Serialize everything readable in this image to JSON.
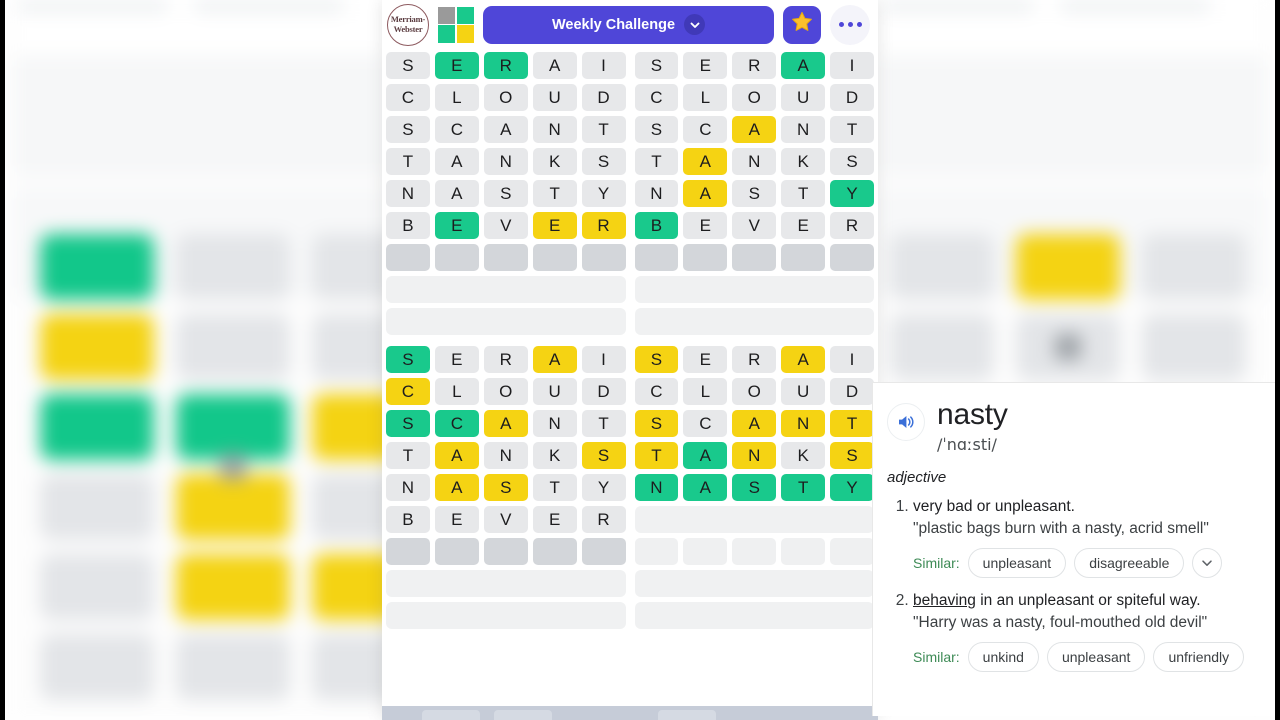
{
  "header": {
    "logo_text_line1": "Merriam-",
    "logo_text_line2": "Webster",
    "quad_icon_name": "quordle-quad-icon",
    "quad_colors": [
      "#9a9a9a",
      "#19c98c",
      "#19c98c",
      "#f5d313"
    ],
    "challenge_label": "Weekly Challenge",
    "star_icon": "star-icon",
    "more_icon": "more-options-icon",
    "accent_purple": "#4f46d8"
  },
  "colors": {
    "green": "#19c98c",
    "yellow": "#f5d313",
    "gray": "#e7e8ea",
    "active_gray": "#d3d6da",
    "placeholder": "#f0f1f2"
  },
  "boards": [
    {
      "name": "board-top-left",
      "solved": false,
      "rows": [
        {
          "letters": [
            "S",
            "E",
            "R",
            "A",
            "I"
          ],
          "states": [
            "gray",
            "green",
            "green",
            "gray",
            "gray"
          ]
        },
        {
          "letters": [
            "C",
            "L",
            "O",
            "U",
            "D"
          ],
          "states": [
            "gray",
            "gray",
            "gray",
            "gray",
            "gray"
          ]
        },
        {
          "letters": [
            "S",
            "C",
            "A",
            "N",
            "T"
          ],
          "states": [
            "gray",
            "gray",
            "gray",
            "gray",
            "gray"
          ]
        },
        {
          "letters": [
            "T",
            "A",
            "N",
            "K",
            "S"
          ],
          "states": [
            "gray",
            "gray",
            "gray",
            "gray",
            "gray"
          ]
        },
        {
          "letters": [
            "N",
            "A",
            "S",
            "T",
            "Y"
          ],
          "states": [
            "gray",
            "gray",
            "gray",
            "gray",
            "gray"
          ]
        },
        {
          "letters": [
            "B",
            "E",
            "V",
            "E",
            "R"
          ],
          "states": [
            "gray",
            "green",
            "gray",
            "yellow",
            "yellow"
          ]
        }
      ],
      "active_row": true,
      "placeholder_bars": 2
    },
    {
      "name": "board-top-right",
      "solved": false,
      "rows": [
        {
          "letters": [
            "S",
            "E",
            "R",
            "A",
            "I"
          ],
          "states": [
            "gray",
            "gray",
            "gray",
            "green",
            "gray"
          ]
        },
        {
          "letters": [
            "C",
            "L",
            "O",
            "U",
            "D"
          ],
          "states": [
            "gray",
            "gray",
            "gray",
            "gray",
            "gray"
          ]
        },
        {
          "letters": [
            "S",
            "C",
            "A",
            "N",
            "T"
          ],
          "states": [
            "gray",
            "gray",
            "yellow",
            "gray",
            "gray"
          ]
        },
        {
          "letters": [
            "T",
            "A",
            "N",
            "K",
            "S"
          ],
          "states": [
            "gray",
            "yellow",
            "gray",
            "gray",
            "gray"
          ]
        },
        {
          "letters": [
            "N",
            "A",
            "S",
            "T",
            "Y"
          ],
          "states": [
            "gray",
            "yellow",
            "gray",
            "gray",
            "green"
          ]
        },
        {
          "letters": [
            "B",
            "E",
            "V",
            "E",
            "R"
          ],
          "states": [
            "green",
            "gray",
            "gray",
            "gray",
            "gray"
          ]
        }
      ],
      "active_row": true,
      "placeholder_bars": 2
    },
    {
      "name": "board-bottom-left",
      "solved": false,
      "rows": [
        {
          "letters": [
            "S",
            "E",
            "R",
            "A",
            "I"
          ],
          "states": [
            "green",
            "gray",
            "gray",
            "yellow",
            "gray"
          ]
        },
        {
          "letters": [
            "C",
            "L",
            "O",
            "U",
            "D"
          ],
          "states": [
            "yellow",
            "gray",
            "gray",
            "gray",
            "gray"
          ]
        },
        {
          "letters": [
            "S",
            "C",
            "A",
            "N",
            "T"
          ],
          "states": [
            "green",
            "green",
            "yellow",
            "gray",
            "gray"
          ]
        },
        {
          "letters": [
            "T",
            "A",
            "N",
            "K",
            "S"
          ],
          "states": [
            "gray",
            "yellow",
            "gray",
            "gray",
            "yellow"
          ]
        },
        {
          "letters": [
            "N",
            "A",
            "S",
            "T",
            "Y"
          ],
          "states": [
            "gray",
            "yellow",
            "yellow",
            "gray",
            "gray"
          ]
        },
        {
          "letters": [
            "B",
            "E",
            "V",
            "E",
            "R"
          ],
          "states": [
            "gray",
            "gray",
            "gray",
            "gray",
            "gray"
          ]
        }
      ],
      "active_row": true,
      "placeholder_bars": 2
    },
    {
      "name": "board-bottom-right",
      "solved": true,
      "rows": [
        {
          "letters": [
            "S",
            "E",
            "R",
            "A",
            "I"
          ],
          "states": [
            "yellow",
            "gray",
            "gray",
            "yellow",
            "gray"
          ]
        },
        {
          "letters": [
            "C",
            "L",
            "O",
            "U",
            "D"
          ],
          "states": [
            "gray",
            "gray",
            "gray",
            "gray",
            "gray"
          ]
        },
        {
          "letters": [
            "S",
            "C",
            "A",
            "N",
            "T"
          ],
          "states": [
            "yellow",
            "gray",
            "yellow",
            "yellow",
            "yellow"
          ]
        },
        {
          "letters": [
            "T",
            "A",
            "N",
            "K",
            "S"
          ],
          "states": [
            "yellow",
            "green",
            "yellow",
            "gray",
            "yellow"
          ]
        },
        {
          "letters": [
            "N",
            "A",
            "S",
            "T",
            "Y"
          ],
          "states": [
            "green",
            "green",
            "green",
            "green",
            "green"
          ]
        }
      ],
      "active_row": false,
      "placeholder_bars": 2,
      "faint_row": true
    }
  ],
  "dictionary": {
    "speaker_icon": "speaker-icon",
    "word": "nasty",
    "phonetic": "/ˈnɑːsti/",
    "part_of_speech": "adjective",
    "definitions": [
      {
        "number": "1.",
        "text_plain": "very bad or unpleasant.",
        "underlined": "",
        "text_rest": "",
        "example": "\"plastic bags burn with a nasty, acrid smell\"",
        "similar_label": "Similar:",
        "similar": [
          "unpleasant",
          "disagreeable"
        ],
        "has_more": true
      },
      {
        "number": "2.",
        "text_plain": "",
        "underlined": "behaving",
        "text_rest": " in an unpleasant or spiteful way.",
        "example": "\"Harry was a nasty, foul-mouthed old devil\"",
        "similar_label": "Similar:",
        "similar": [
          "unkind",
          "unpleasant",
          "unfriendly"
        ],
        "has_more": false
      }
    ]
  }
}
